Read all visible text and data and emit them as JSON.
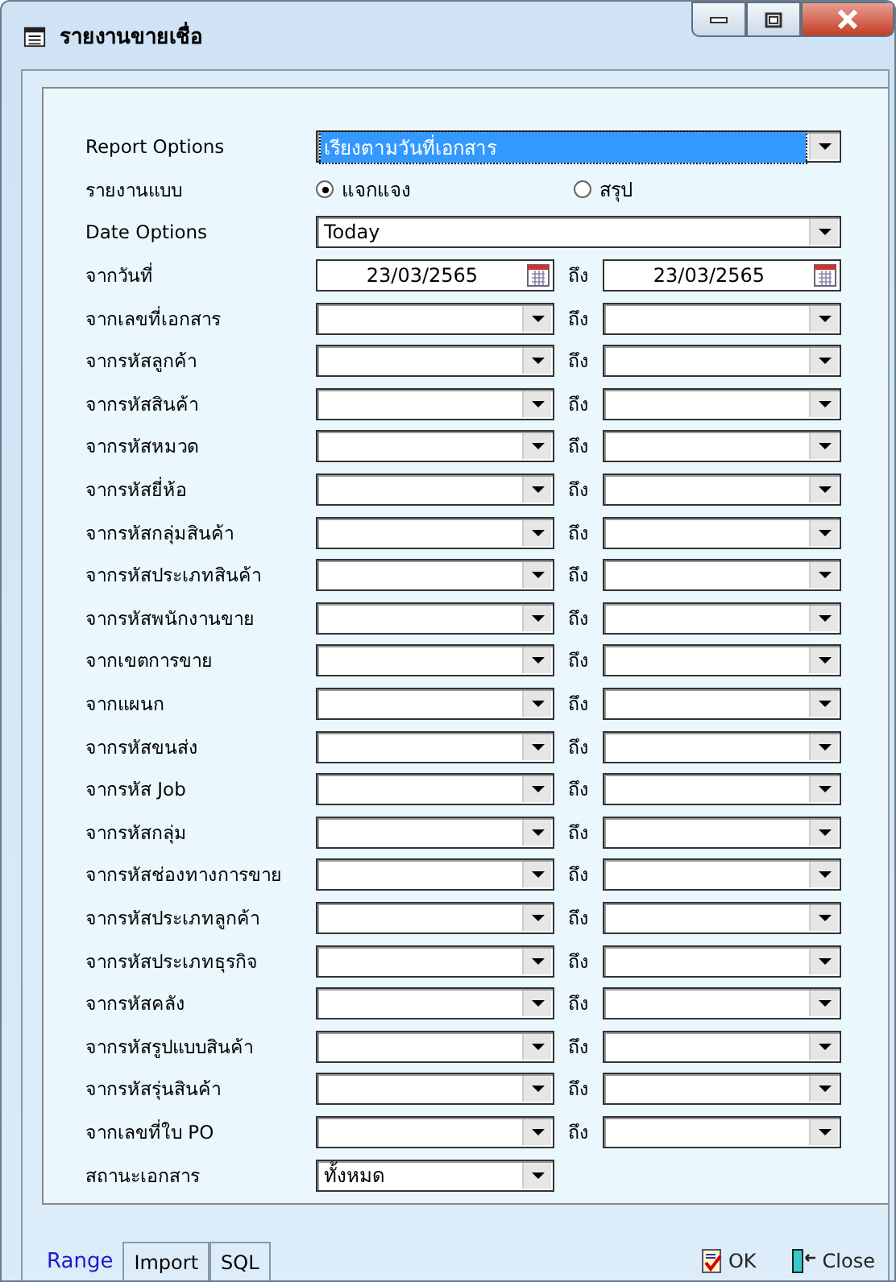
{
  "window": {
    "title": "รายงานขายเชื่อ"
  },
  "report_options": {
    "label": "Report Options",
    "value": "เรียงตามวันที่เอกสาร",
    "selected": true
  },
  "report_type": {
    "label": "รายงานแบบ",
    "options": [
      {
        "label": "แจกแจง",
        "selected": true
      },
      {
        "label": "สรุป",
        "selected": false
      }
    ]
  },
  "date_options": {
    "label": "Date Options",
    "value": "Today"
  },
  "date_range": {
    "label": "จากวันที่",
    "from": "23/03/2565",
    "to_label": "ถึง",
    "to": "23/03/2565"
  },
  "ranges": [
    {
      "label": "จากเลขที่เอกสาร",
      "to_label": "ถึง"
    },
    {
      "label": "จากรหัสลูกค้า",
      "to_label": "ถึง"
    },
    {
      "label": "จากรหัสสินค้า",
      "to_label": "ถึง"
    },
    {
      "label": "จากรหัสหมวด",
      "to_label": "ถึง"
    },
    {
      "label": "จากรหัสยี่ห้อ",
      "to_label": "ถึง"
    },
    {
      "label": "จากรหัสกลุ่มสินค้า",
      "to_label": "ถึง"
    },
    {
      "label": "จากรหัสประเภทสินค้า",
      "to_label": "ถึง"
    },
    {
      "label": "จากรหัสพนักงานขาย",
      "to_label": "ถึง"
    },
    {
      "label": "จากเขตการขาย",
      "to_label": "ถึง"
    },
    {
      "label": "จากแผนก",
      "to_label": "ถึง"
    },
    {
      "label": "จากรหัสขนส่ง",
      "to_label": "ถึง"
    },
    {
      "label": "จากรหัส Job",
      "to_label": "ถึง"
    },
    {
      "label": "จากรหัสกลุ่ม",
      "to_label": "ถึง"
    },
    {
      "label": "จากรหัสช่องทางการขาย",
      "to_label": "ถึง"
    },
    {
      "label": "จากรหัสประเภทลูกค้า",
      "to_label": "ถึง"
    },
    {
      "label": "จากรหัสประเภทธุรกิจ",
      "to_label": "ถึง"
    },
    {
      "label": "จากรหัสคลัง",
      "to_label": "ถึง"
    },
    {
      "label": "จากรหัสรูปแบบสินค้า",
      "to_label": "ถึง"
    },
    {
      "label": "จากรหัสรุ่นสินค้า",
      "to_label": "ถึง"
    },
    {
      "label": "จากเลขที่ใบ PO",
      "to_label": "ถึง"
    }
  ],
  "status": {
    "label": "สถานะเอกสาร",
    "value": "ทั้งหมด"
  },
  "tabs": [
    {
      "label": "Range",
      "selected": true
    },
    {
      "label": "Import",
      "selected": false
    },
    {
      "label": "SQL",
      "selected": false
    }
  ],
  "buttons": [
    {
      "label": "OK",
      "kind": "ok"
    },
    {
      "label": "Close",
      "kind": "close"
    }
  ]
}
